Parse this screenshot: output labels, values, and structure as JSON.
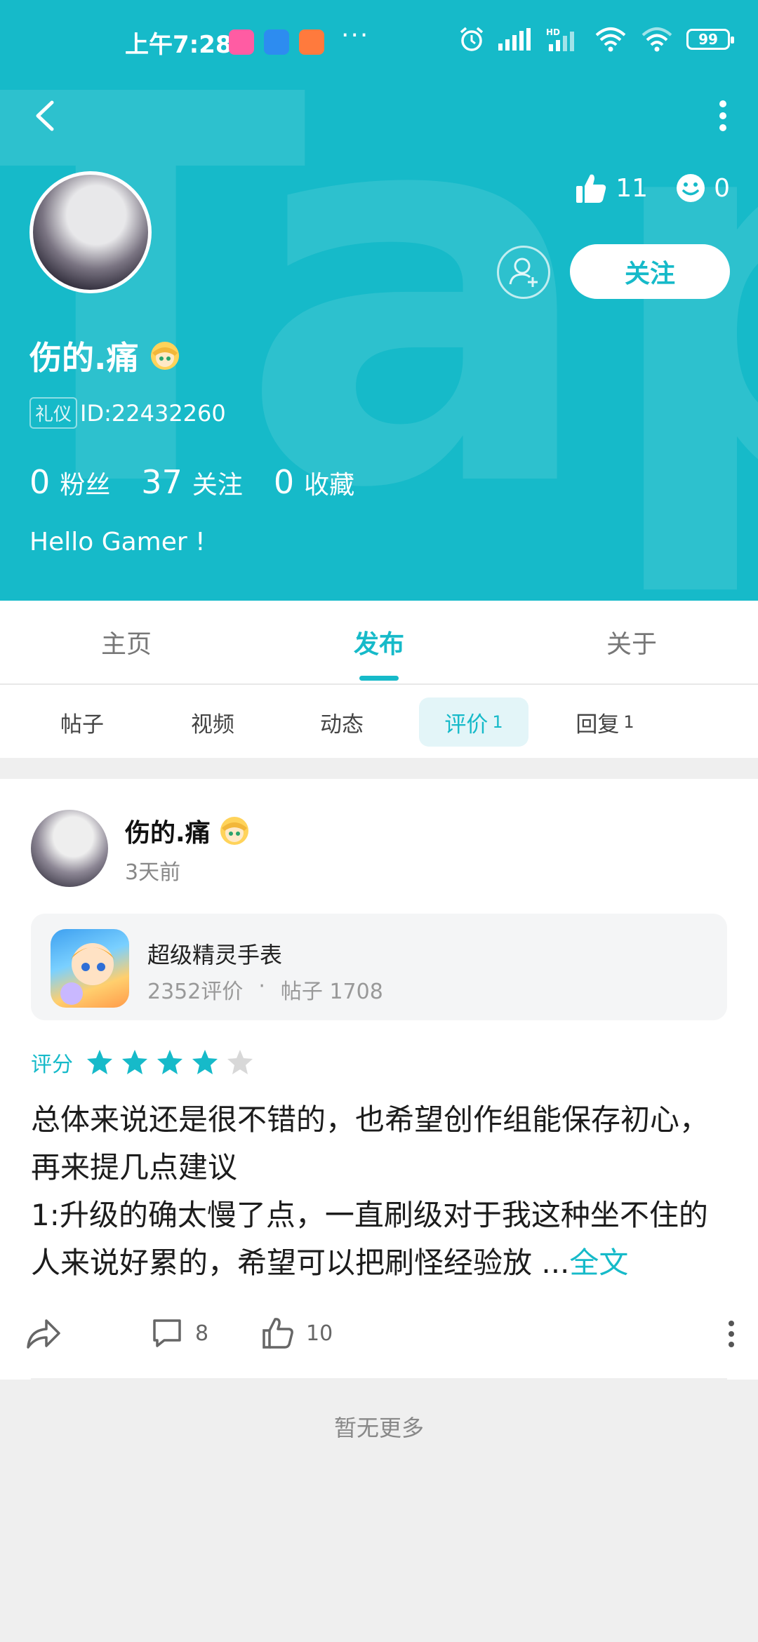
{
  "status_bar": {
    "time": "上午7:28",
    "more": "···",
    "battery": "99"
  },
  "colors": {
    "accent": "#16bac9",
    "star_on": "#16bac9",
    "star_off": "#d8d8d8"
  },
  "profile": {
    "likes": "11",
    "smiles": "0",
    "follow_label": "关注",
    "name": "伤的.痛",
    "badge": "礼仪",
    "id_text": "ID:22432260",
    "fans_count": "0",
    "fans_label": "粉丝",
    "following_count": "37",
    "following_label": "关注",
    "favorites_count": "0",
    "favorites_label": "收藏",
    "bio": "Hello Gamer !"
  },
  "tabs": [
    {
      "label": "主页"
    },
    {
      "label": "发布"
    },
    {
      "label": "关于"
    }
  ],
  "subtabs": [
    {
      "label": "帖子",
      "count": ""
    },
    {
      "label": "视频",
      "count": ""
    },
    {
      "label": "动态",
      "count": ""
    },
    {
      "label": "评价",
      "count": "1"
    },
    {
      "label": "回复",
      "count": "1"
    }
  ],
  "post": {
    "author": "伤的.痛",
    "time": "3天前",
    "game_name": "超级精灵手表",
    "game_reviews": "2352评价",
    "game_dot": "·",
    "game_posts": "帖子 1708",
    "rating_label": "评分",
    "rating": 4,
    "rating_max": 5,
    "text": "总体来说还是很不错的，也希望创作组能保存初心，再来提几点建议\n1:升级的确太慢了点，一直刷级对于我这种坐不住的人来说好累的，希望可以把刷怪经验放 ...",
    "more_label": "全文",
    "comments": "8",
    "likes": "10"
  },
  "footer": {
    "no_more": "暂无更多"
  }
}
